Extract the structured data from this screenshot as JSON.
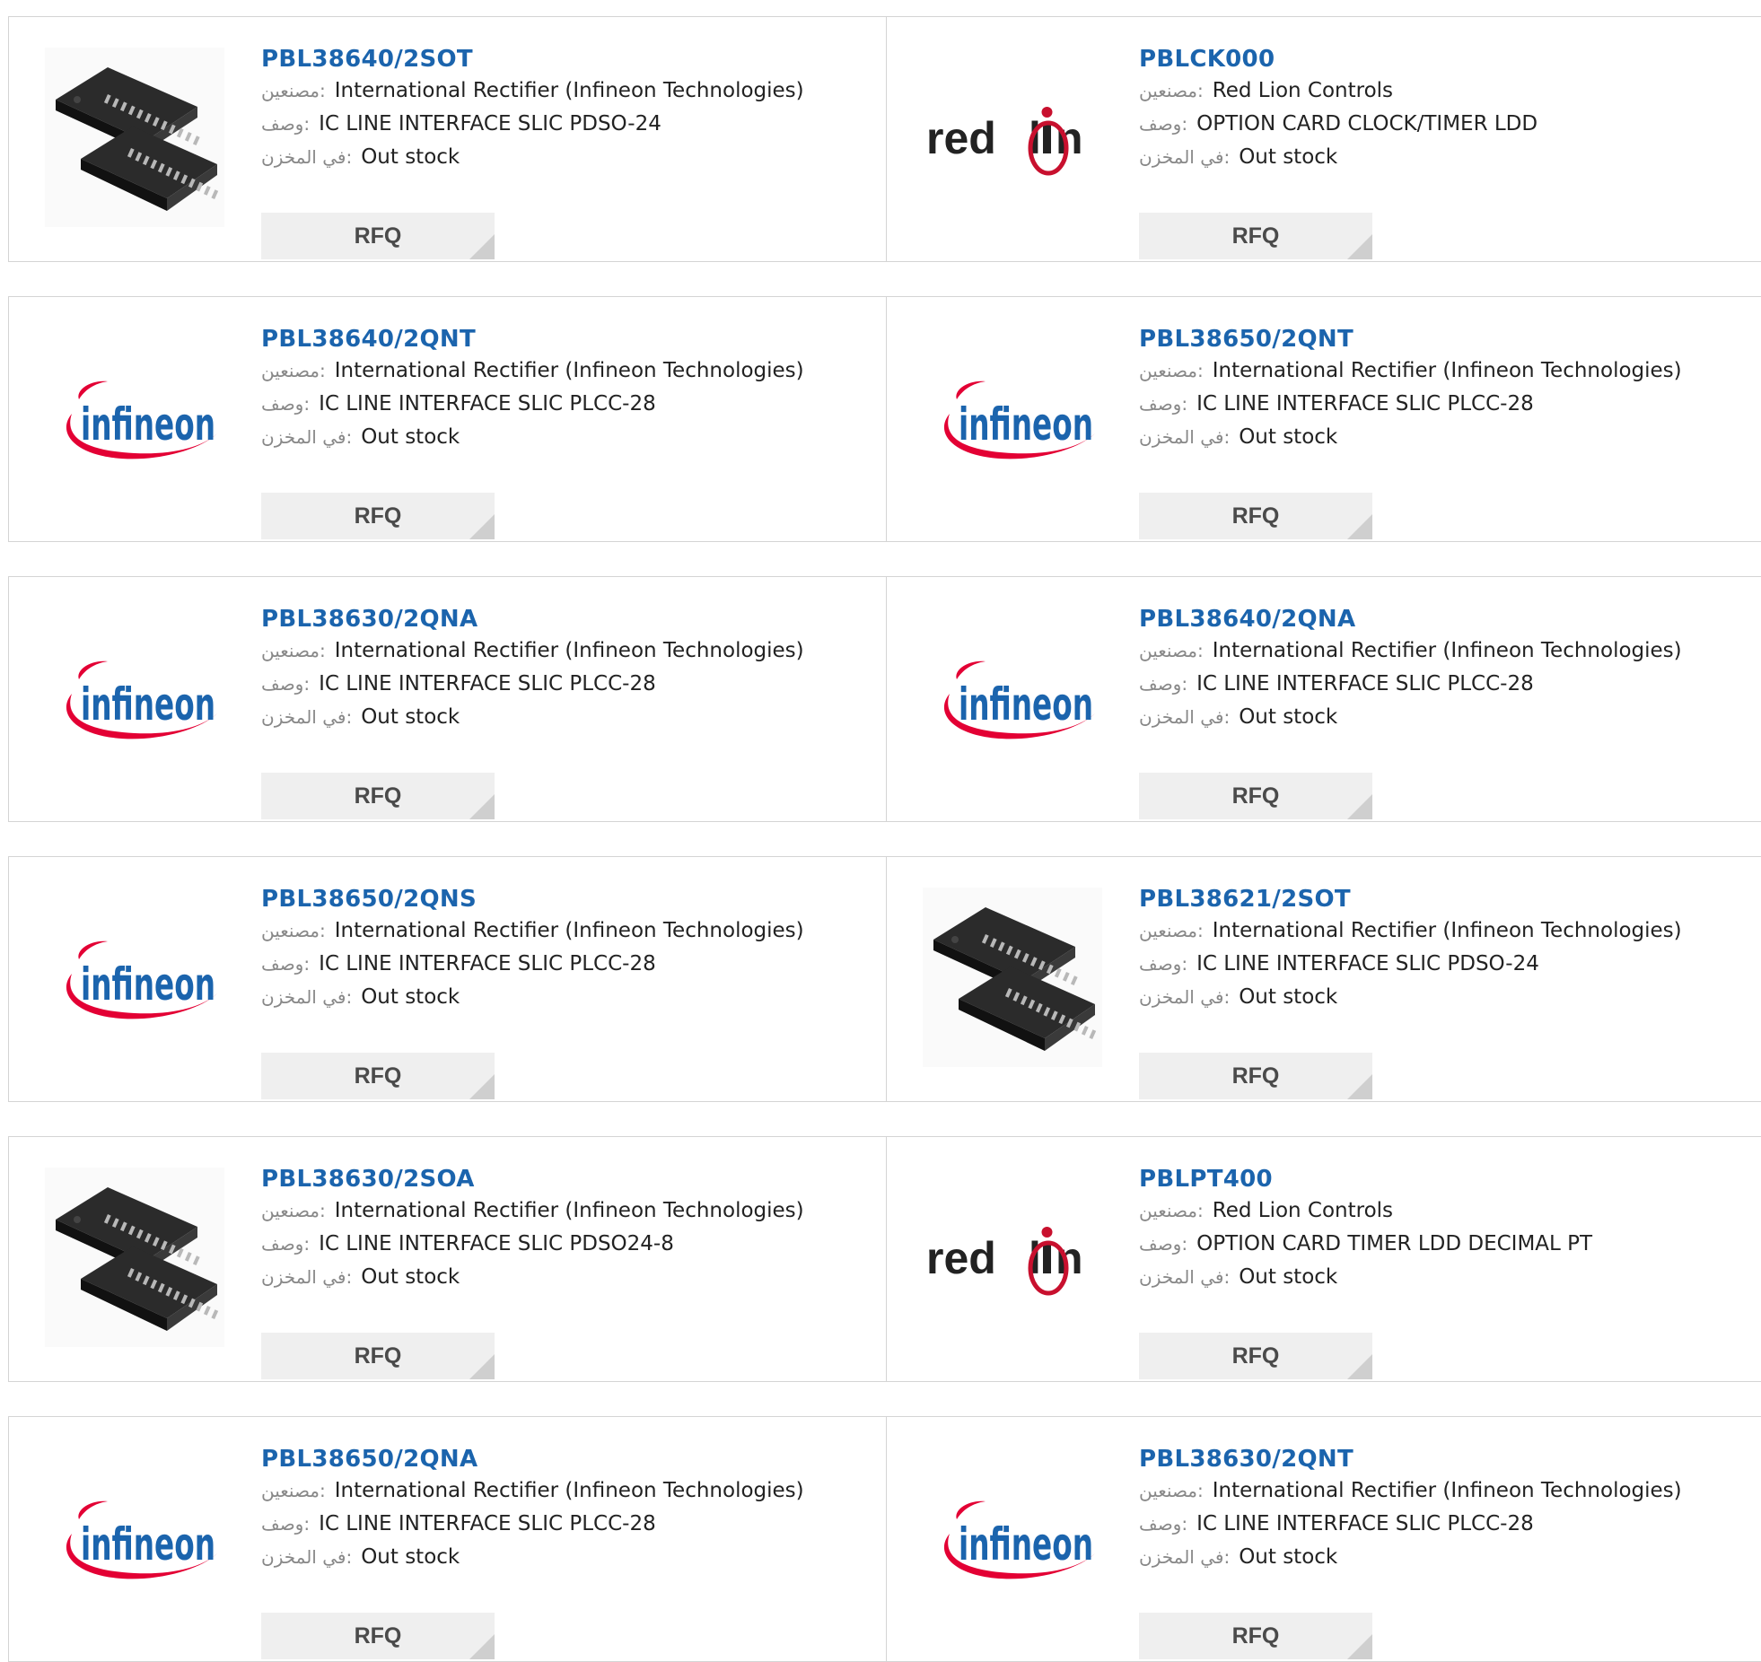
{
  "labels": {
    "manufacturer": "مصنعين:",
    "description": "وصف:",
    "stock": "في المخزن:",
    "rfq": "RFQ"
  },
  "colors": {
    "part_link": "#1b64ad",
    "border": "#d4d4d4",
    "rfq_bg": "#efefef",
    "infineon_red": "#e30034",
    "infineon_blue": "#1b64ad"
  },
  "products": [
    {
      "part": "PBL38640/2SOT",
      "manufacturer": "International Rectifier (Infineon Technologies)",
      "description": "IC LINE INTERFACE SLIC PDSO-24",
      "stock": "Out stock",
      "image": "chip-image"
    },
    {
      "part": "PBLCK000",
      "manufacturer": "Red Lion Controls",
      "description": "OPTION CARD CLOCK/TIMER LDD",
      "stock": "Out stock",
      "image": "redlion-logo"
    },
    {
      "part": "PBL38640/2QNT",
      "manufacturer": "International Rectifier (Infineon Technologies)",
      "description": "IC LINE INTERFACE SLIC PLCC-28",
      "stock": "Out stock",
      "image": "infineon-logo"
    },
    {
      "part": "PBL38650/2QNT",
      "manufacturer": "International Rectifier (Infineon Technologies)",
      "description": "IC LINE INTERFACE SLIC PLCC-28",
      "stock": "Out stock",
      "image": "infineon-logo"
    },
    {
      "part": "PBL38630/2QNA",
      "manufacturer": "International Rectifier (Infineon Technologies)",
      "description": "IC LINE INTERFACE SLIC PLCC-28",
      "stock": "Out stock",
      "image": "infineon-logo"
    },
    {
      "part": "PBL38640/2QNA",
      "manufacturer": "International Rectifier (Infineon Technologies)",
      "description": "IC LINE INTERFACE SLIC PLCC-28",
      "stock": "Out stock",
      "image": "infineon-logo"
    },
    {
      "part": "PBL38650/2QNS",
      "manufacturer": "International Rectifier (Infineon Technologies)",
      "description": "IC LINE INTERFACE SLIC PLCC-28",
      "stock": "Out stock",
      "image": "infineon-logo"
    },
    {
      "part": "PBL38621/2SOT",
      "manufacturer": "International Rectifier (Infineon Technologies)",
      "description": "IC LINE INTERFACE SLIC PDSO-24",
      "stock": "Out stock",
      "image": "chip-image"
    },
    {
      "part": "PBL38630/2SOA",
      "manufacturer": "International Rectifier (Infineon Technologies)",
      "description": "IC LINE INTERFACE SLIC PDSO24-8",
      "stock": "Out stock",
      "image": "chip-image"
    },
    {
      "part": "PBLPT400",
      "manufacturer": "Red Lion Controls",
      "description": "OPTION CARD TIMER LDD DECIMAL PT",
      "stock": "Out stock",
      "image": "redlion-logo"
    },
    {
      "part": "PBL38650/2QNA",
      "manufacturer": "International Rectifier (Infineon Technologies)",
      "description": "IC LINE INTERFACE SLIC PLCC-28",
      "stock": "Out stock",
      "image": "infineon-logo"
    },
    {
      "part": "PBL38630/2QNT",
      "manufacturer": "International Rectifier (Infineon Technologies)",
      "description": "IC LINE INTERFACE SLIC PLCC-28",
      "stock": "Out stock",
      "image": "infineon-logo"
    }
  ]
}
